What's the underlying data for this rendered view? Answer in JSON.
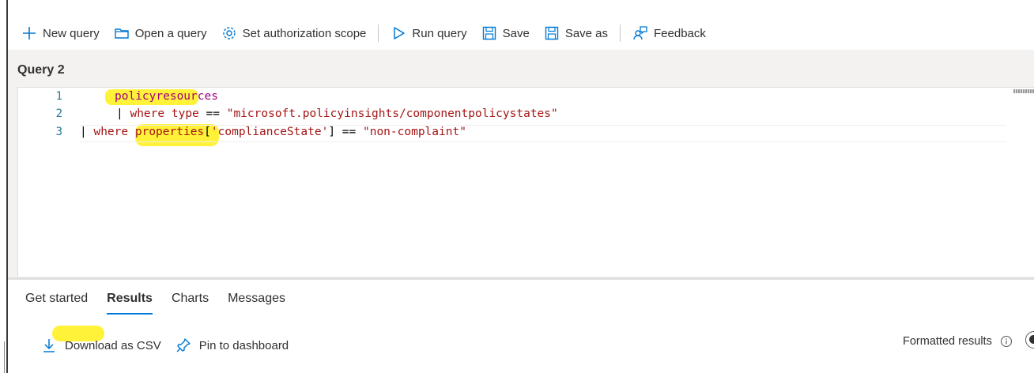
{
  "toolbar": {
    "new_query": "New query",
    "open_query": "Open a query",
    "set_scope": "Set authorization scope",
    "run_query": "Run query",
    "save": "Save",
    "save_as": "Save as",
    "feedback": "Feedback"
  },
  "query": {
    "title": "Query 2",
    "lines": [
      {
        "number": "1",
        "table": "policyresources"
      },
      {
        "number": "2",
        "pipe": "|",
        "keyword": "where",
        "field": "type",
        "operator": "==",
        "value": "\"microsoft.policyinsights/componentpolicystates\""
      },
      {
        "number": "3",
        "pipe": "|",
        "keyword": "where",
        "field": "properties",
        "open_bracket": "[",
        "key": "'complianceState'",
        "close_bracket": "]",
        "operator": "==",
        "value": "\"non-complaint\""
      }
    ]
  },
  "tabs": [
    "Get started",
    "Results",
    "Charts",
    "Messages"
  ],
  "active_tab": "Results",
  "results": {
    "download_csv": "Download as CSV",
    "pin_dashboard": "Pin to dashboard",
    "formatted_results": "Formatted results",
    "formatted_results_on": true
  },
  "icons": {
    "new_query": "plus-icon",
    "open_query": "folder-open-icon",
    "set_scope": "gear-icon",
    "run_query": "play-icon",
    "save": "save-icon",
    "save_as": "save-as-icon",
    "feedback": "feedback-person-icon",
    "download": "download-icon",
    "pin": "pin-icon",
    "info": "info-icon"
  },
  "colors": {
    "accent": "#0078d4",
    "highlight": "#ffee00",
    "keyword": "#a31515",
    "table_name": "#a0007e",
    "line_number": "#237893"
  }
}
